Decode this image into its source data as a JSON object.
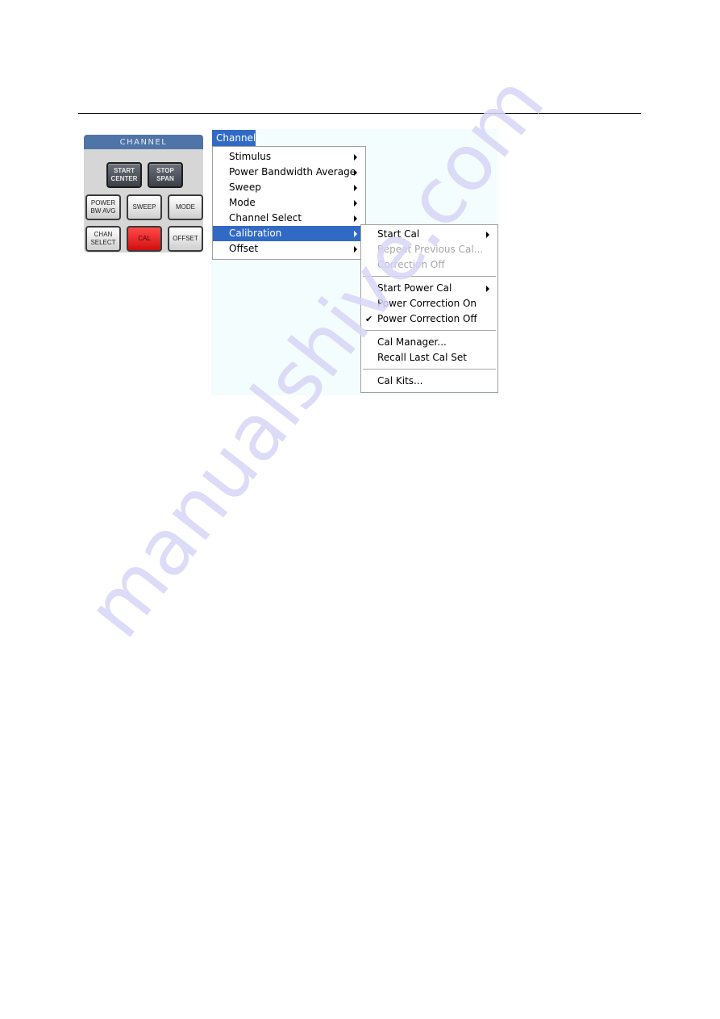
{
  "panel": {
    "title": "CHANNEL",
    "buttons": [
      {
        "label": "START\nCENTER",
        "style": "dark"
      },
      {
        "label": "STOP\nSPAN",
        "style": "dark"
      },
      {
        "label": "POWER\nBW AVG",
        "style": "light"
      },
      {
        "label": "SWEEP",
        "style": "light"
      },
      {
        "label": "MODE",
        "style": "light"
      },
      {
        "label": "CHAN\nSELECT",
        "style": "light"
      },
      {
        "label": "CAL",
        "style": "red",
        "active": true
      },
      {
        "label": "OFFSET",
        "style": "light"
      }
    ],
    "colors": {
      "title_bar": "#4f74a8",
      "active_button": "#e01c1c"
    }
  },
  "menubar": {
    "active_menu": "Channel"
  },
  "channel_menu": {
    "items": [
      {
        "label": "Stimulus",
        "submenu": true
      },
      {
        "label": "Power Bandwidth Average",
        "submenu": true
      },
      {
        "label": "Sweep",
        "submenu": true
      },
      {
        "label": "Mode",
        "submenu": true
      },
      {
        "label": "Channel Select",
        "submenu": true
      },
      {
        "label": "Calibration",
        "submenu": true,
        "selected": true
      },
      {
        "label": "Offset",
        "submenu": true
      }
    ]
  },
  "calibration_submenu": {
    "groups": [
      [
        {
          "label": "Start Cal",
          "submenu": true
        },
        {
          "label": "Repeat Previous Cal...",
          "disabled": true
        },
        {
          "label": "Correction Off",
          "disabled": true
        }
      ],
      [
        {
          "label": "Start Power Cal",
          "submenu": true
        },
        {
          "label": "Power Correction On"
        },
        {
          "label": "Power Correction Off",
          "checked": true
        }
      ],
      [
        {
          "label": "Cal Manager..."
        },
        {
          "label": "Recall Last Cal Set"
        }
      ],
      [
        {
          "label": "Cal Kits..."
        }
      ]
    ]
  },
  "colors": {
    "selection": "#316ac5",
    "disabled_text": "#a7a6aa"
  },
  "watermark": "manualshive.com"
}
